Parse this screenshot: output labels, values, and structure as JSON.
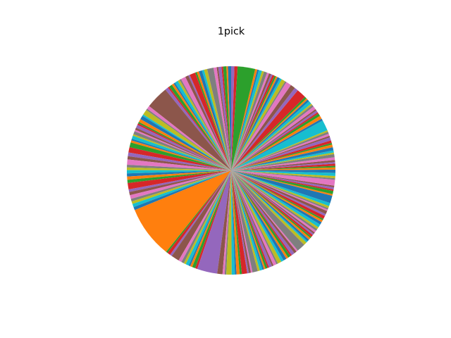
{
  "chart_data": {
    "type": "pie",
    "title": "1pick",
    "start_angle_deg": 90,
    "direction": "counterclockwise",
    "palette": [
      "#1f77b4",
      "#ff7f0e",
      "#2ca02c",
      "#d62728",
      "#9467bd",
      "#8c564b",
      "#e377c2",
      "#7f7f7f",
      "#bcbd22",
      "#17becf"
    ],
    "labels": [],
    "values": [
      0.6,
      0.3,
      0.6,
      0.3,
      0.6,
      0.3,
      0.6,
      1.2,
      0.6,
      0.4,
      0.6,
      0.4,
      0.3,
      1.1,
      0.3,
      0.6,
      0.9,
      0.3,
      0.4,
      0.6,
      0.3,
      0.4,
      0.6,
      0.3,
      0.6,
      4.3,
      0.6,
      0.3,
      1.0,
      0.3,
      0.7,
      0.6,
      0.3,
      0.3,
      0.6,
      0.4,
      0.3,
      0.6,
      0.3,
      0.6,
      0.3,
      0.4,
      0.9,
      1.0,
      0.7,
      0.6,
      1.0,
      0.5,
      0.5,
      0.6,
      0.6,
      0.6,
      0.6,
      1.2,
      0.5,
      0.6,
      0.7,
      0.5,
      0.5,
      0.6,
      0.6,
      9.8,
      0.3,
      0.6,
      0.4,
      1.5,
      0.6,
      0.5,
      0.4,
      0.6,
      0.3,
      0.4,
      0.6,
      0.4,
      3.8,
      1.0,
      0.4,
      0.3,
      1.0,
      0.6,
      0.3,
      0.6,
      0.4,
      1.0,
      0.3,
      0.4,
      0.3,
      1.0,
      0.4,
      0.5,
      0.3,
      0.3,
      0.4,
      0.3,
      0.6,
      0.3,
      0.6,
      0.3,
      0.7,
      0.5,
      0.6,
      0.4,
      0.5,
      0.3,
      0.6,
      0.5,
      0.3,
      1.6,
      0.6,
      0.3,
      0.4,
      0.4,
      0.3,
      0.4,
      0.3,
      0.3,
      0.4,
      0.4,
      0.4,
      0.6,
      0.5,
      0.4,
      0.3,
      0.6,
      0.4,
      0.6,
      0.3,
      0.3,
      0.4,
      0.6,
      1.4,
      0.3,
      0.6,
      0.3,
      0.4,
      0.3,
      1.1,
      0.3,
      0.4,
      0.6,
      0.6,
      0.4,
      0.3,
      0.4,
      0.3,
      0.4,
      0.5,
      0.6,
      0.3,
      0.4,
      0.6,
      0.5,
      0.3,
      0.5,
      0.6,
      0.3,
      0.4,
      0.4,
      0.3,
      2.0,
      0.4,
      0.6,
      0.5,
      0.3,
      0.4,
      0.3,
      0.6,
      0.4,
      0.3,
      0.6,
      0.4,
      0.3,
      0.4,
      1.8,
      0.7,
      0.9,
      1.0,
      0.3,
      0.7,
      0.4,
      0.5,
      0.3,
      0.3,
      0.4,
      0.3,
      0.4,
      0.4,
      0.6,
      0.4,
      0.6,
      0.3,
      0.4,
      3.3,
      0.6,
      0.6
    ]
  }
}
